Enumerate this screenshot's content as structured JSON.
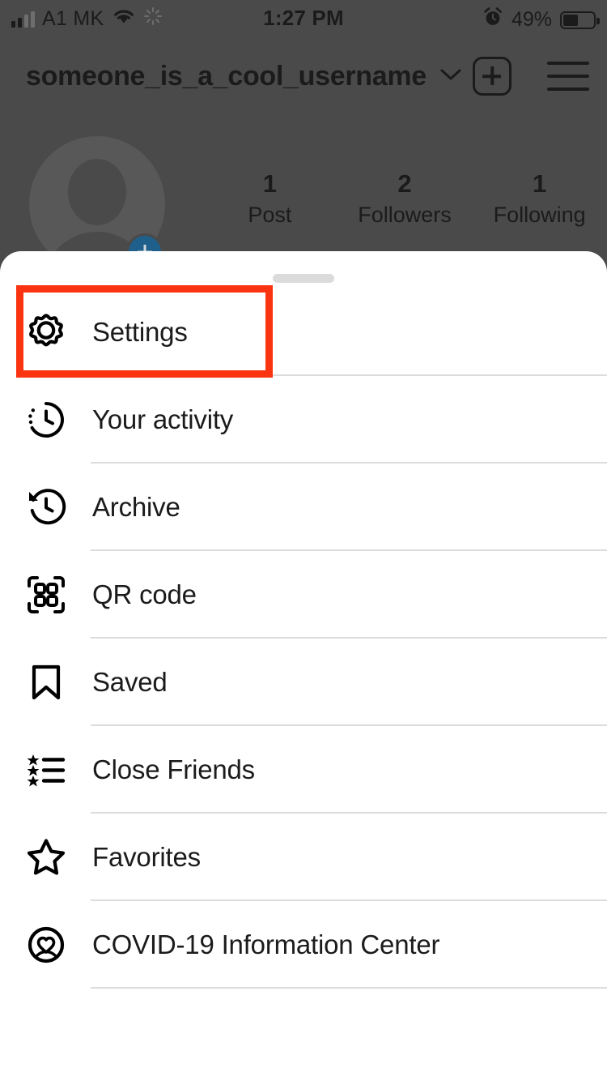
{
  "status_bar": {
    "carrier": "A1 MK",
    "time": "1:27 PM",
    "battery_percent": "49%",
    "signal_icon": "signal-bars-icon",
    "wifi_icon": "wifi-icon",
    "sync_icon": "sync-spinner-icon",
    "alarm_icon": "alarm-clock-icon",
    "battery_icon": "battery-icon",
    "battery_level": 49
  },
  "profile": {
    "username": "someone_is_a_cool_username",
    "username_chevron_icon": "chevron-down-icon",
    "add_post_icon": "plus-square-icon",
    "menu_icon": "hamburger-menu-icon",
    "avatar_icon": "avatar-placeholder",
    "avatar_add_icon": "add-avatar-badge-icon",
    "stats": [
      {
        "value": "1",
        "label": "Post"
      },
      {
        "value": "2",
        "label": "Followers"
      },
      {
        "value": "1",
        "label": "Following"
      }
    ]
  },
  "sheet": {
    "drag_handle": "drag-handle",
    "items": [
      {
        "label": "Settings",
        "icon": "gear-icon"
      },
      {
        "label": "Your activity",
        "icon": "clock-activity-icon"
      },
      {
        "label": "Archive",
        "icon": "clock-rewind-icon"
      },
      {
        "label": "QR code",
        "icon": "qr-code-icon"
      },
      {
        "label": "Saved",
        "icon": "bookmark-icon"
      },
      {
        "label": "Close Friends",
        "icon": "star-list-icon"
      },
      {
        "label": "Favorites",
        "icon": "star-outline-icon"
      },
      {
        "label": "COVID-19 Information Center",
        "icon": "heart-circle-icon"
      }
    ]
  },
  "annotation": {
    "target": "Settings",
    "color": "#fa3411"
  },
  "colors": {
    "backdrop": "#4a4a4a",
    "sheet_background": "#ffffff",
    "text": "#1b1b1b",
    "divider": "#dcdcdc",
    "avatar_badge": "#1f5f8b",
    "highlight": "#fa3411"
  }
}
